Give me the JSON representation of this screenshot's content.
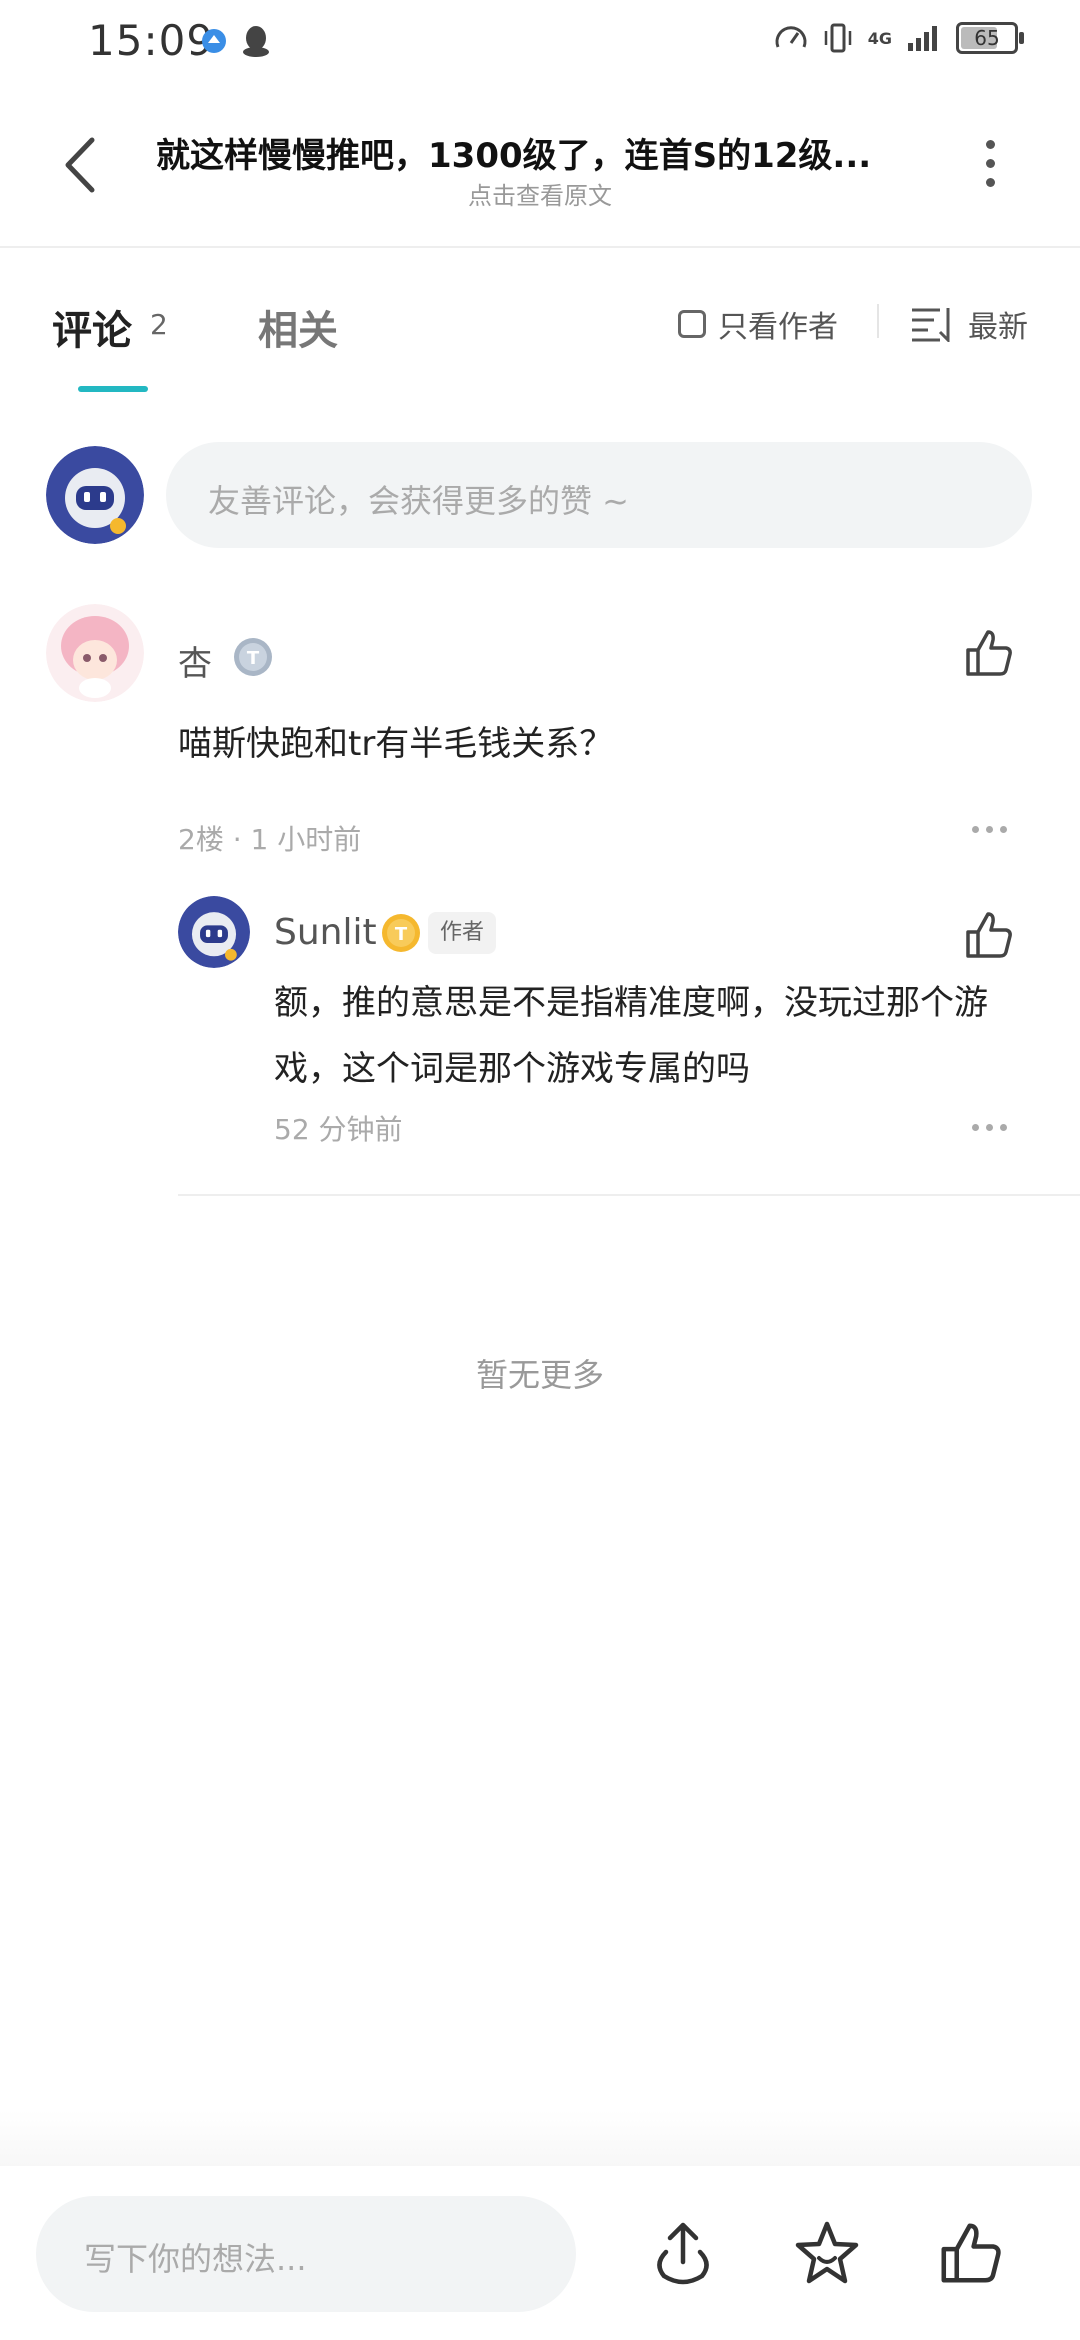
{
  "status": {
    "time": "15:09",
    "network": "4G",
    "battery": "65",
    "battery_level": 0.65
  },
  "header": {
    "title": "就这样慢慢推吧，1300级了，连首S的12级...",
    "subtitle": "点击查看原文"
  },
  "tabs": {
    "comments_label": "评论",
    "comments_count": "2",
    "related_label": "相关",
    "only_author_label": "只看作者",
    "sort_label": "最新"
  },
  "composer": {
    "placeholder": "友善评论，会获得更多的赞 ~"
  },
  "comments": [
    {
      "name": "杏",
      "text": "喵斯快跑和tr有半毛钱关系？",
      "meta": "2楼 · 1 小时前",
      "replies": [
        {
          "name": "Sunlit",
          "tag": "作者",
          "text": "额，推的意思是不是指精准度啊，没玩过那个游戏，这个词是那个游戏专属的吗",
          "meta": "52 分钟前"
        }
      ]
    }
  ],
  "footer": {
    "no_more": "暂无更多",
    "write_placeholder": "写下你的想法..."
  },
  "colors": {
    "accent": "#23b8c2",
    "badge_gold": "#f5b82e",
    "badge_grey": "#a9b6c6"
  }
}
